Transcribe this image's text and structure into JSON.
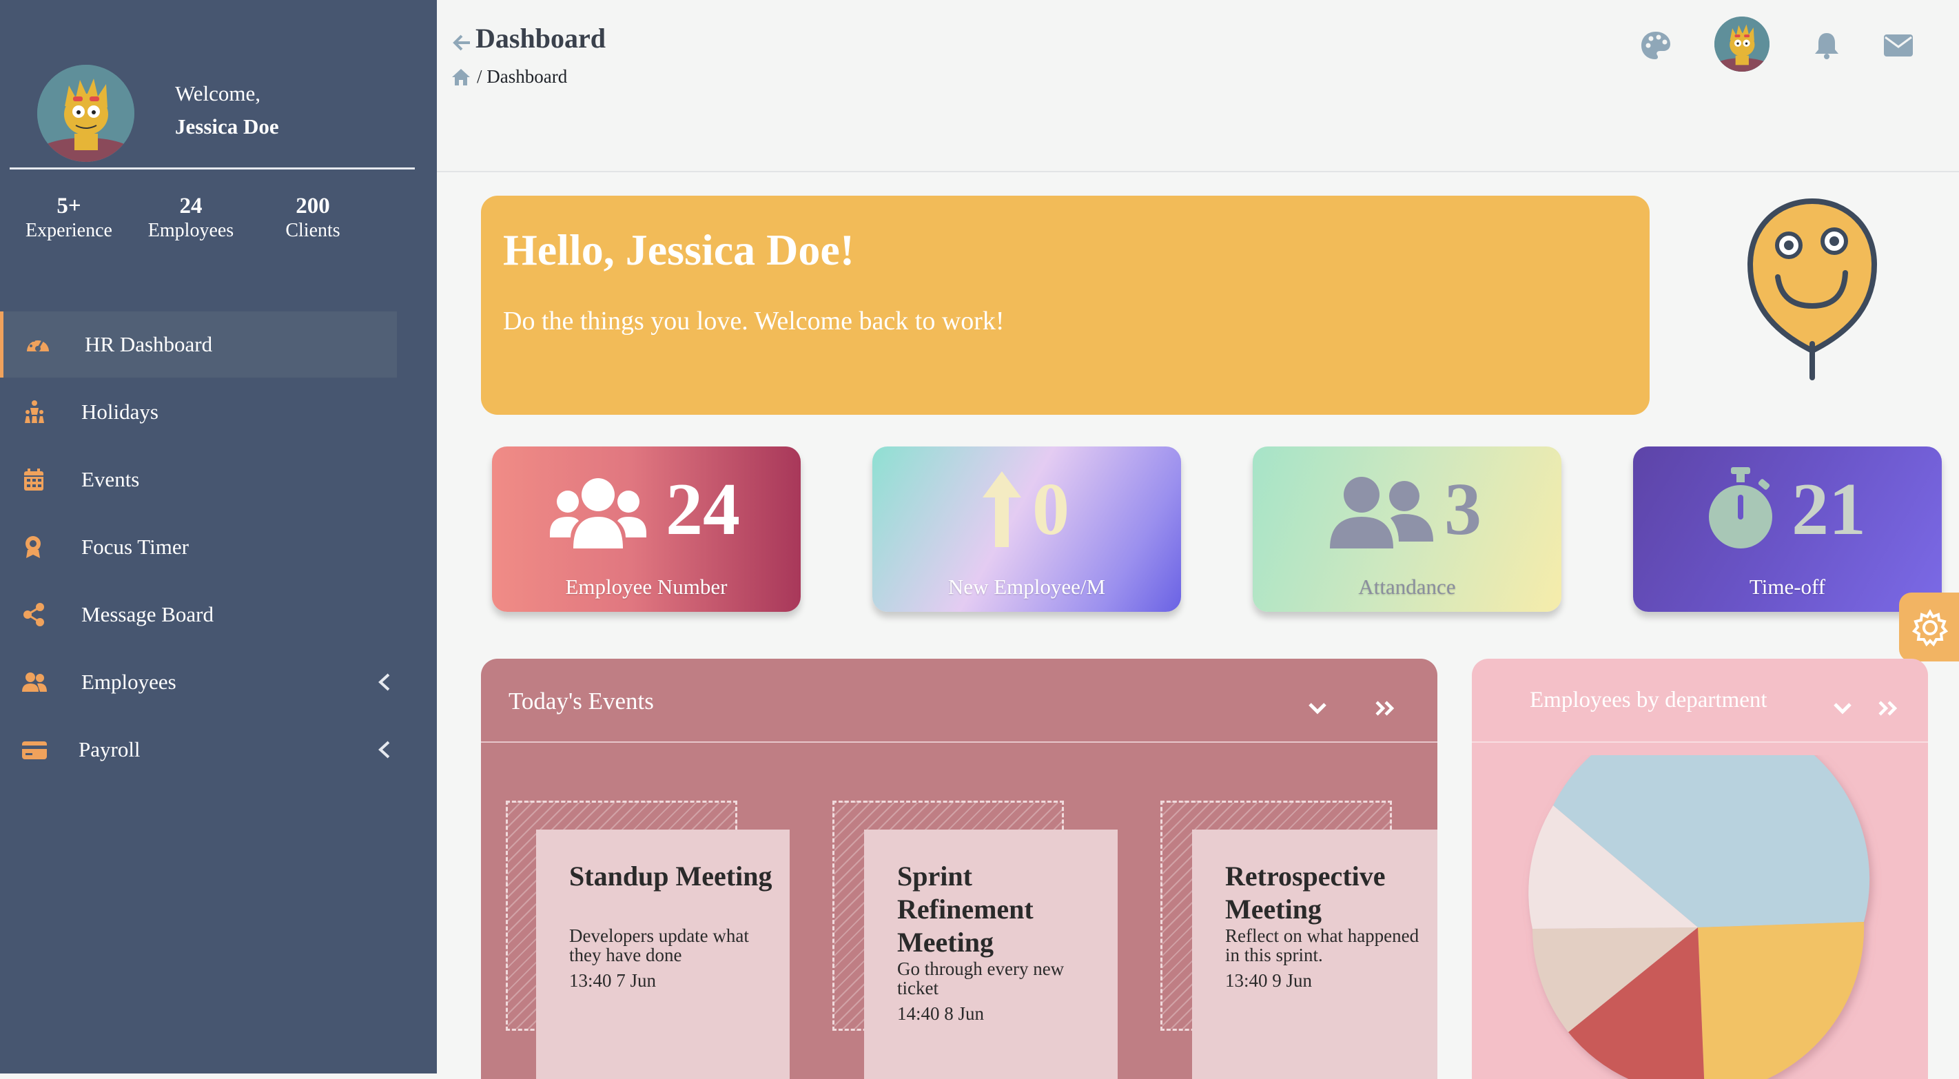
{
  "sidebar": {
    "welcome": "Welcome,",
    "user_name": "Jessica Doe",
    "stats": [
      {
        "value": "5+",
        "label": "Experience"
      },
      {
        "value": "24",
        "label": "Employees"
      },
      {
        "value": "200",
        "label": "Clients"
      }
    ],
    "nav": [
      {
        "label": "HR Dashboard",
        "icon": "gauge-icon",
        "active": true
      },
      {
        "label": "Holidays",
        "icon": "people-icon"
      },
      {
        "label": "Events",
        "icon": "calendar-icon"
      },
      {
        "label": "Focus Timer",
        "icon": "award-icon"
      },
      {
        "label": "Message Board",
        "icon": "share-icon"
      },
      {
        "label": "Employees",
        "icon": "users-icon",
        "expandable": true
      },
      {
        "label": "Payroll",
        "icon": "credit-card-icon",
        "expandable": true
      }
    ]
  },
  "header": {
    "title": "Dashboard",
    "breadcrumb": "/ Dashboard",
    "icons": [
      "palette-icon",
      "avatar",
      "bell-icon",
      "envelope-icon"
    ]
  },
  "hello": {
    "title": "Hello, Jessica Doe!",
    "subtitle": "Do the things you love. Welcome back to work!"
  },
  "cards": [
    {
      "value": "24",
      "label": "Employee Number",
      "icon": "users-icon"
    },
    {
      "value": "0",
      "label": "New Employee/M",
      "icon": "arrow-up-icon"
    },
    {
      "value": "3",
      "label": "Attandance",
      "icon": "user-friends-icon"
    },
    {
      "value": "21",
      "label": "Time-off",
      "icon": "stopwatch-icon"
    }
  ],
  "events": {
    "title": "Today's Events",
    "items": [
      {
        "title": "Standup Meeting",
        "description": "Developers update what they have done",
        "time": "13:40 7 Jun"
      },
      {
        "title": "Sprint Refinement Meeting",
        "description": "Go through every new ticket",
        "time": "14:40 8 Jun"
      },
      {
        "title": "Retrospective Meeting",
        "description": "Reflect on what happened in this sprint.",
        "time": "13:40 9 Jun"
      }
    ]
  },
  "department": {
    "title": "Employees by department",
    "slice_colors": [
      "#b8d2de",
      "#f2c265",
      "#c95a58",
      "#e3cfc3",
      "#f1e3e2"
    ]
  },
  "colors": {
    "sidebar": "#475670",
    "accent": "#f0a25c",
    "hello_bg": "#f2bb58",
    "events_bg": "#bf7e84",
    "dept_bg": "#f4c0c8"
  }
}
